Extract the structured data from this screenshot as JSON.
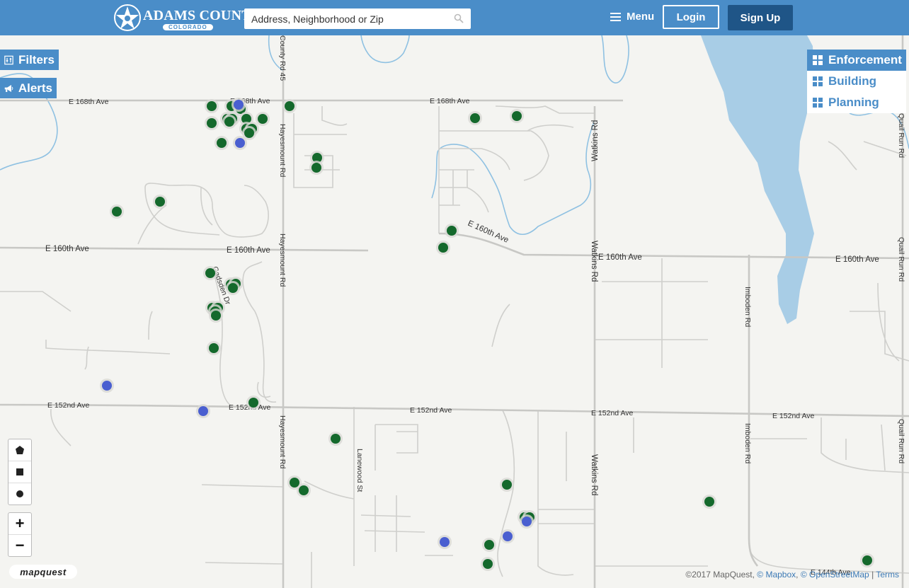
{
  "header": {
    "logo_title": "ADAMS COUNTY",
    "logo_subtitle": "COLORADO",
    "search_placeholder": "Address, Neighborhood or Zip",
    "menu_label": "Menu",
    "login_label": "Login",
    "signup_label": "Sign Up"
  },
  "side_buttons": {
    "filters_label": "Filters",
    "alerts_label": "Alerts"
  },
  "layers": [
    {
      "label": "Enforcement",
      "active": true
    },
    {
      "label": "Building",
      "active": false
    },
    {
      "label": "Planning",
      "active": false
    }
  ],
  "map": {
    "zoom_in": "+",
    "zoom_out": "−",
    "provider_logo": "mapquest",
    "roads": {
      "e168": "E 168th Ave",
      "e160": "E 160th Ave",
      "e152": "E 152nd Ave",
      "e144": "E 144th Ave",
      "hayesmount": "Hayesmount Rd",
      "county45": "County Rd 45",
      "watkins": "Watkins Rd",
      "imboden": "Imboden Rd",
      "quailrun": "Quail Run Rd",
      "gadsden": "Gadsden Dr",
      "lanewood": "Lanewood St"
    },
    "colors": {
      "enforcement_green": "#14692c",
      "enforcement_blue": "#4a5fd0",
      "water": "#a8cde6",
      "header_blue": "#4a8dc8"
    }
  },
  "attribution": {
    "copyright": "©2017 MapQuest,",
    "mapbox": "© Mapbox",
    "sep1": ",",
    "osm": "© OpenStreetMap",
    "sep2": "|",
    "terms": "Terms"
  }
}
